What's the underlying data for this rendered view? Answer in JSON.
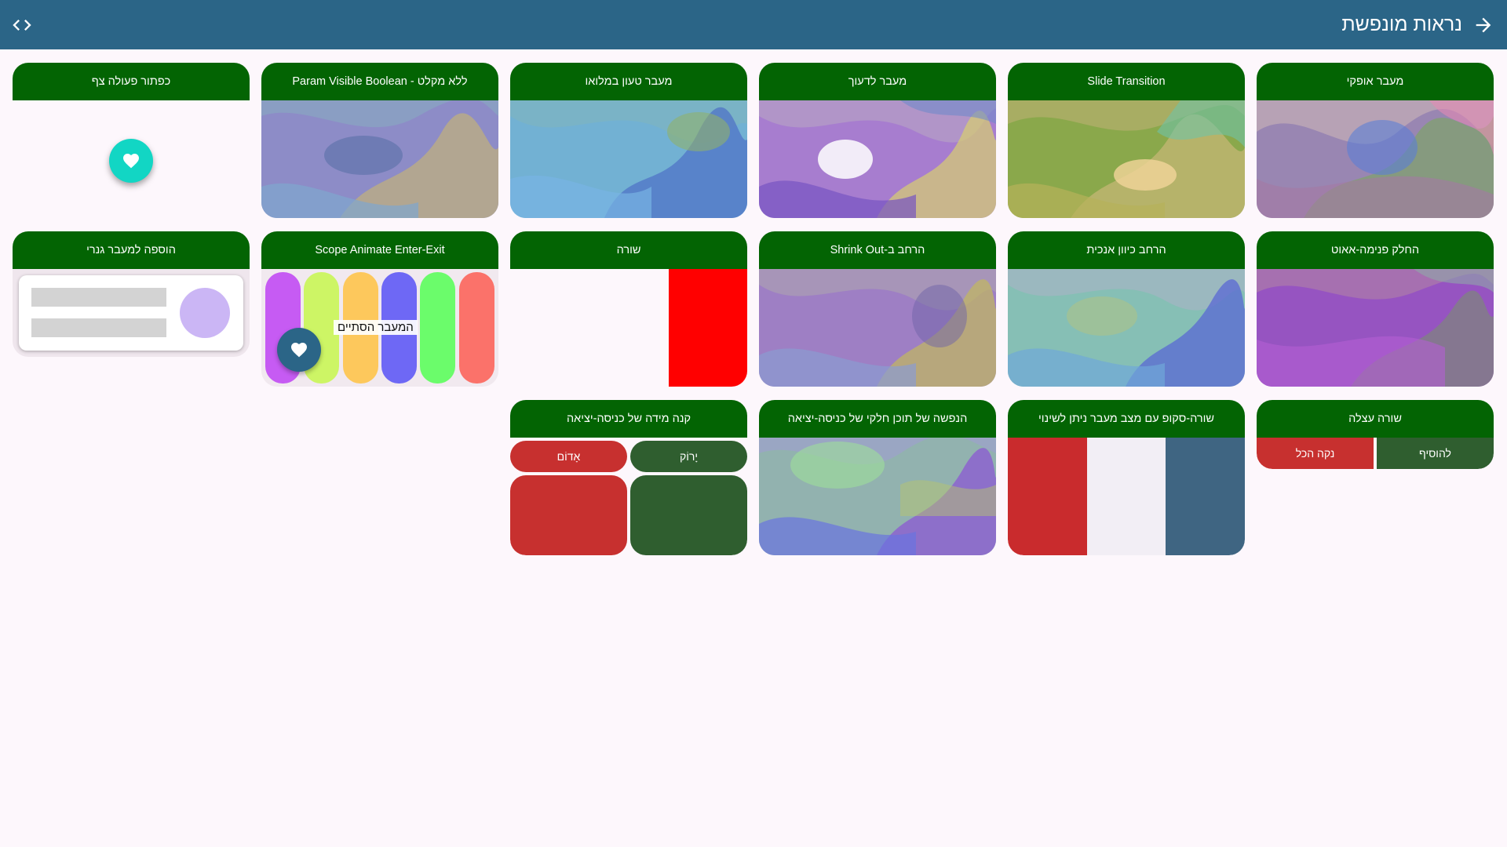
{
  "appbar": {
    "title": "נראות מונפשת",
    "back_icon": "arrow-forward-icon",
    "code_icon": "code-icon"
  },
  "colors": {
    "appbar": "#2b6587",
    "card_header": "#036403",
    "fab_teal": "#12d6c4",
    "red_button": "#c7302f",
    "green_button": "#2f5e2f",
    "flag_red": "#c92b2d",
    "flag_white": "#f2eef5",
    "flag_blue": "#3f6582"
  },
  "cards": {
    "horizontal_transition": {
      "title": "מעבר אופקי"
    },
    "slide_transition": {
      "title": "Slide Transition"
    },
    "fade_transition": {
      "title": "מעבר לדעוך"
    },
    "fully_loaded_transition": {
      "title": "מעבר טעון במלואו"
    },
    "param_visible_boolean": {
      "title": "ללא מקלט - Param Visible Boolean"
    },
    "fab": {
      "title": "כפתור פעולה צף"
    },
    "slide_in_out": {
      "title": "החלק פנימה-אאוט"
    },
    "expand_vertical": {
      "title": "הרחב כיוון אנכית"
    },
    "shrink_out": {
      "title": "הרחב ב-Shrink Out"
    },
    "row": {
      "title": "שורה"
    },
    "scope_animate": {
      "title": "Scope Animate Enter-Exit",
      "label": "המעבר הסתיים"
    },
    "shared_transition": {
      "title": "הוספה למעבר גנרי"
    },
    "lazy_row": {
      "title": "שורה עצלה",
      "add_label": "להוסיף",
      "clear_label": "נקה הכל"
    },
    "row_scope_mutable": {
      "title": "שורה-סקופ עם מצב מעבר ניתן לשינוי"
    },
    "partial_content": {
      "title": "הנפשה של תוכן חלקי של כניסה-יציאה"
    },
    "scale_enter_exit": {
      "title": "קנה מידה של כניסה-יציאה",
      "green_label": "יָרוֹק",
      "red_label": "אָדוֹם"
    }
  }
}
